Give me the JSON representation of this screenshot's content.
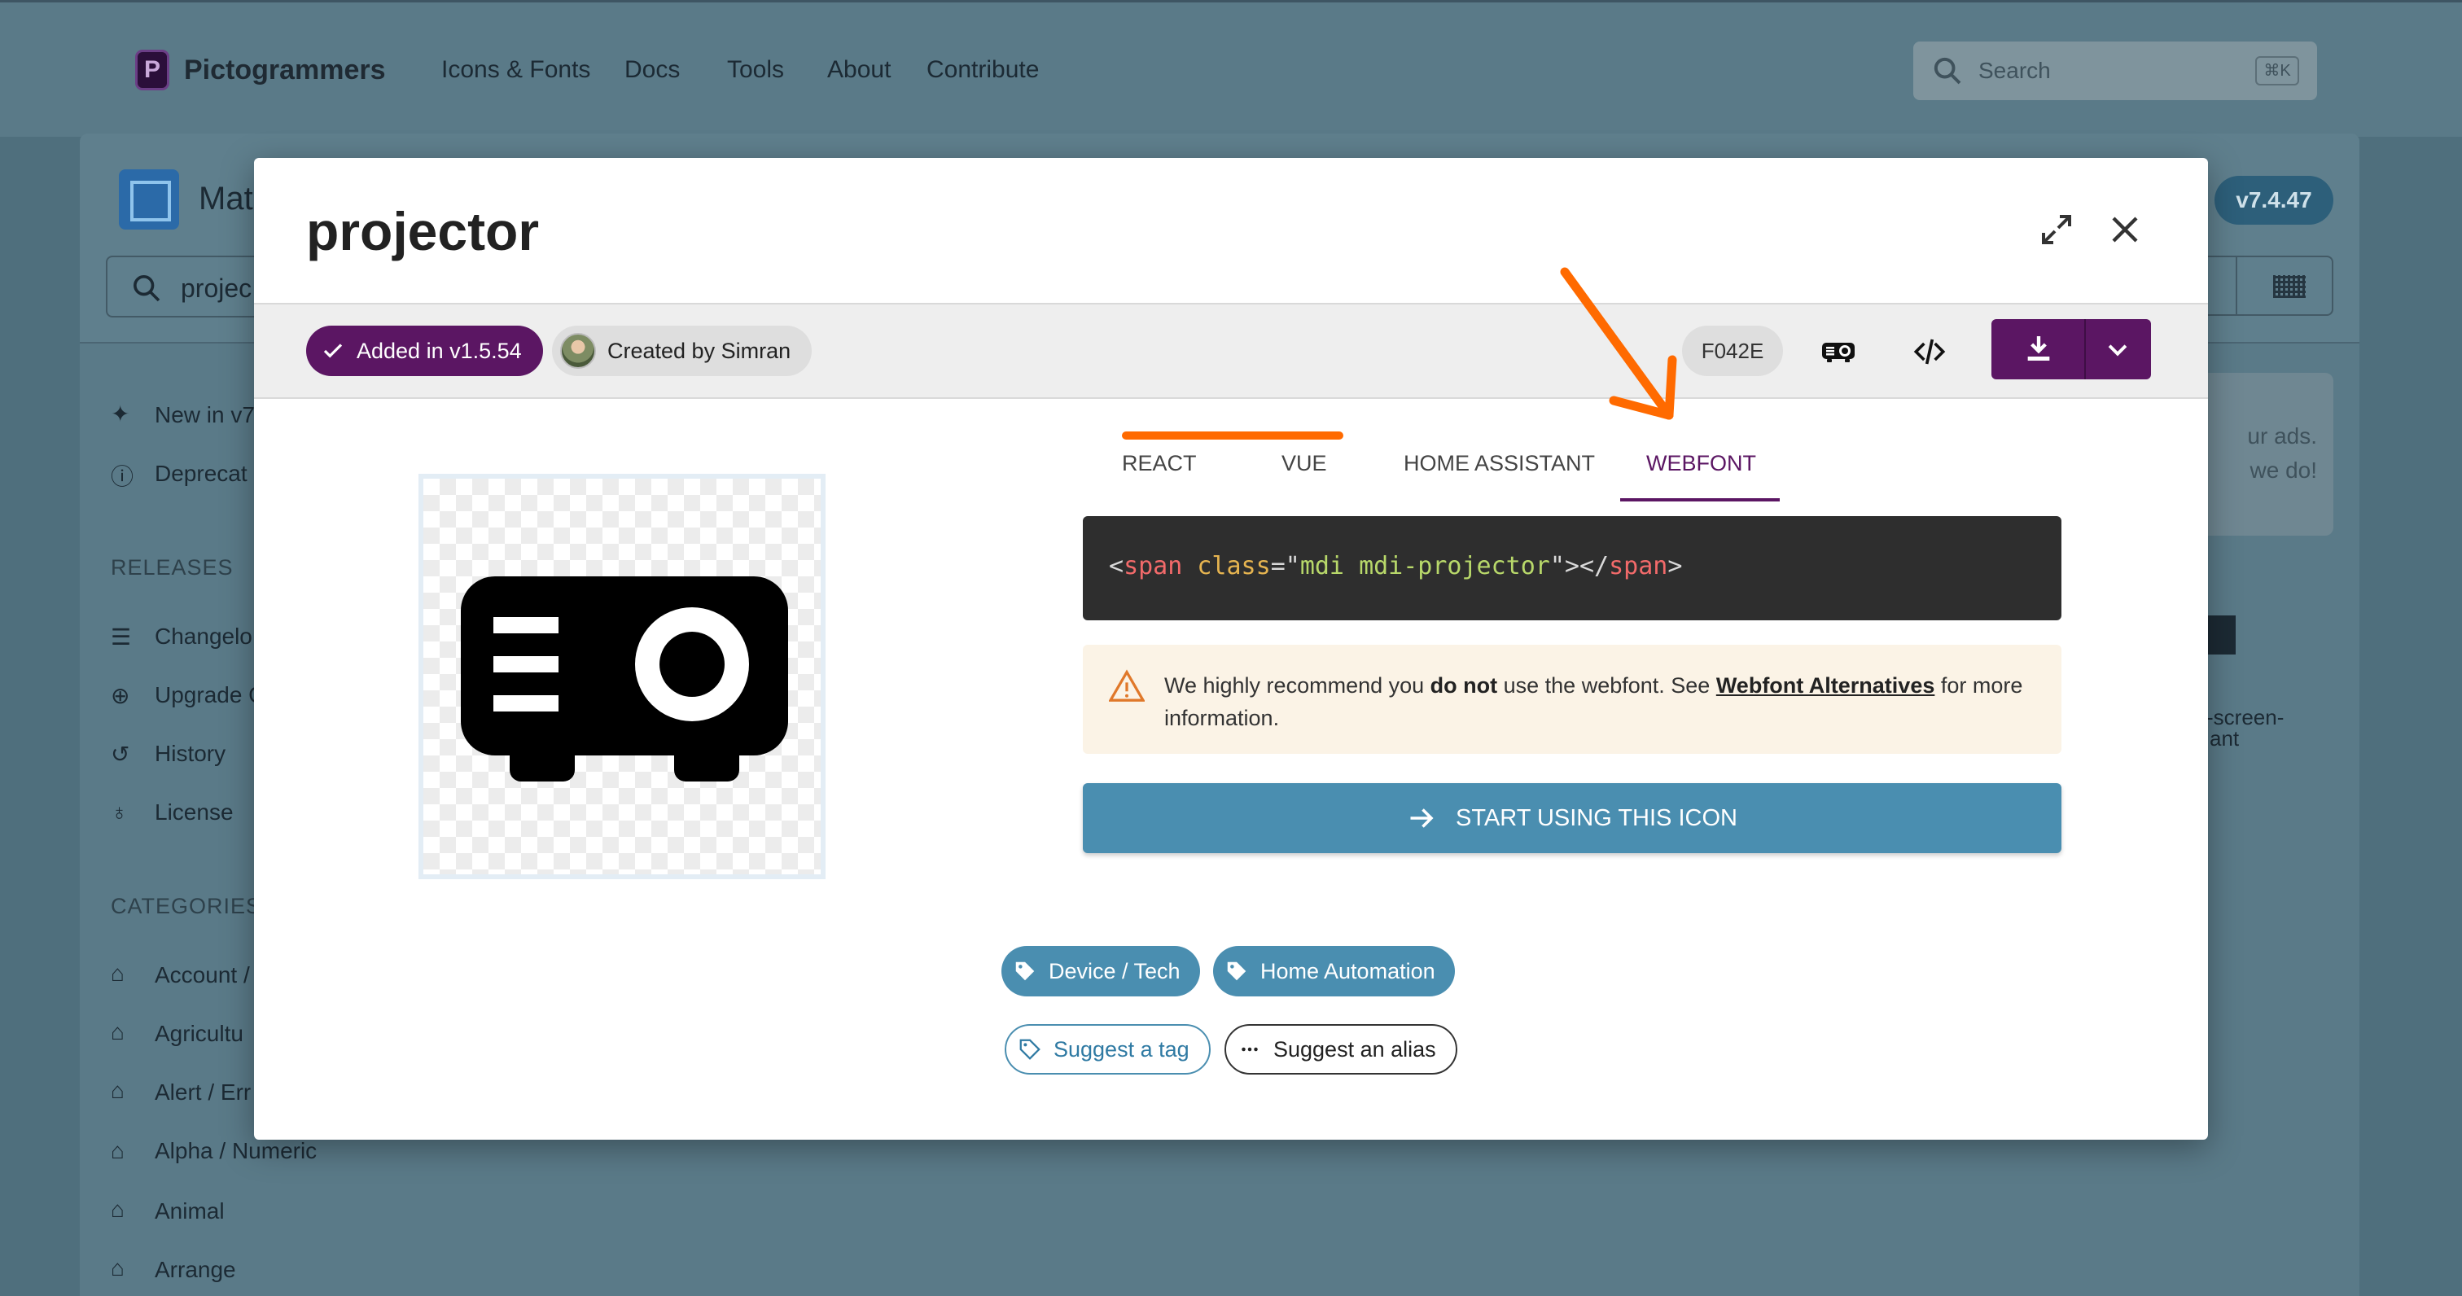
{
  "site": {
    "logo_letter": "P",
    "brand": "Pictogrammers",
    "nav": [
      "Icons & Fonts",
      "Docs",
      "Tools",
      "About",
      "Contribute"
    ],
    "search_placeholder": "Search",
    "search_shortcut": "⌘K"
  },
  "background": {
    "title_partial": "Mat",
    "search_value_partial": "projec",
    "version": "v7.4.47",
    "sidebar_top": [
      "New in v7",
      "Deprecat"
    ],
    "releases_heading": "RELEASES",
    "releases": [
      "Changelo",
      "Upgrade G",
      "History",
      "License"
    ],
    "categories_heading": "CATEGORIES",
    "categories": [
      "Account /",
      "Agricultu",
      "Alert / Err",
      "Alpha / Numeric",
      "Animal",
      "Arrange"
    ],
    "ad_line1": "ur ads.",
    "ad_line2": "we do!",
    "right_partial_1": "-screen-",
    "right_partial_2": "ant"
  },
  "modal": {
    "title": "projector",
    "added_label": "Added in v1.5.54",
    "author_label": "Created by Simran",
    "codepoint": "F042E",
    "tabs": [
      "REACT",
      "VUE",
      "HOME ASSISTANT",
      "WEBFONT"
    ],
    "active_tab": "WEBFONT",
    "code": {
      "open_bracket": "<",
      "tag": "span",
      "attr": "class",
      "eq_quote": "=\"",
      "class_mdi": "mdi",
      "class_icon": "mdi-projector",
      "close": "\"></",
      "tag_close": "span",
      "end": ">"
    },
    "warning": {
      "pre": "We highly recommend you ",
      "bold": "do not",
      "mid": " use the webfont. See ",
      "link": "Webfont Alternatives",
      "post": " for more information."
    },
    "start_button": "START USING THIS ICON",
    "tags": [
      "Device / Tech",
      "Home Automation"
    ],
    "suggest_tag": "Suggest a tag",
    "suggest_alias": "Suggest an alias"
  },
  "colors": {
    "brand_purple": "#5b1663",
    "accent_blue": "#4a8eb0",
    "annotation_orange": "#ff6a00",
    "code_bg": "#2e2e2e",
    "warning_bg": "#fbf3e6"
  },
  "icons": {
    "expand": "arrows-expand-icon",
    "close": "close-x-icon",
    "check": "check-icon",
    "projector_small": "projector-icon",
    "code": "code-brackets-icon",
    "download": "download-icon",
    "chevron": "chevron-down-icon",
    "warning": "alert-triangle-icon",
    "arrow_right": "arrow-right-icon",
    "tag": "tag-icon",
    "dots": "dots-horizontal-icon"
  }
}
